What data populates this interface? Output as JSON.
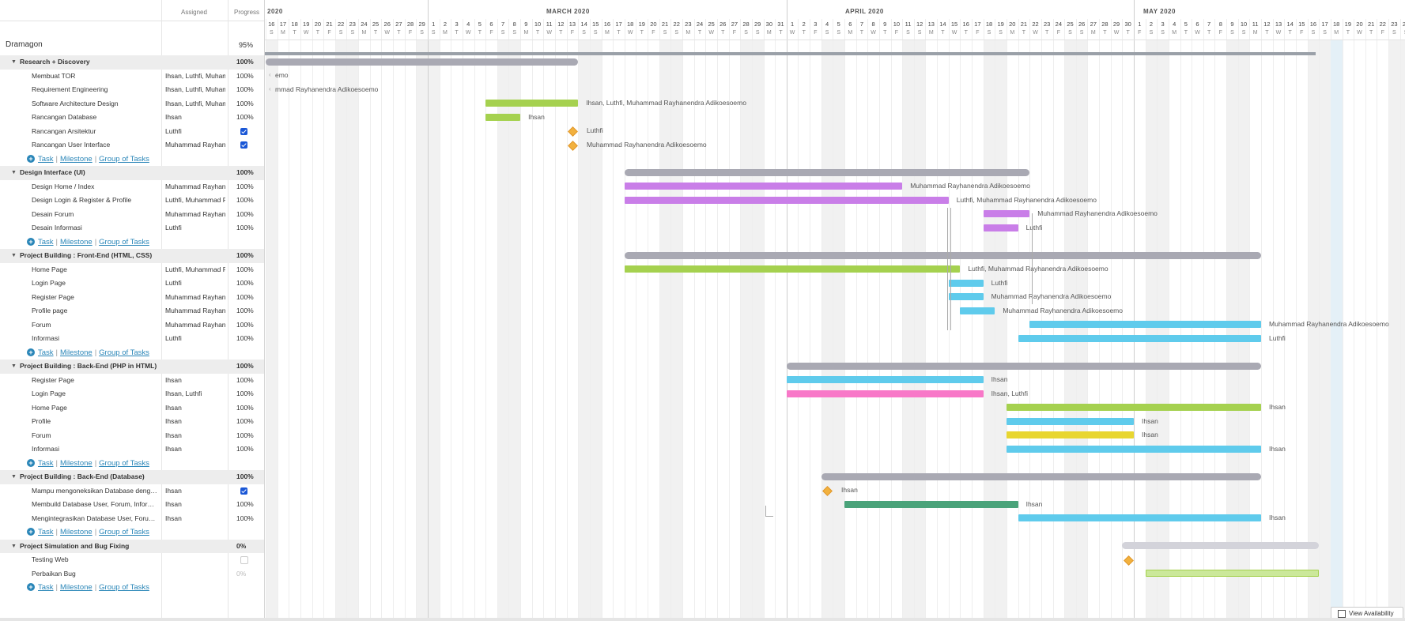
{
  "columns": {
    "assigned": "Assigned",
    "progress": "Progress"
  },
  "project": {
    "title": "Dramagon",
    "progress": "95%"
  },
  "rows": [
    {
      "type": "group",
      "name": "Research + Discovery",
      "progress": "100%"
    },
    {
      "type": "task",
      "name": "Membuat TOR",
      "assigned": "Ihsan, Luthfi, Muhammad Rayhanendra Adikoesoemo",
      "progress": "100%"
    },
    {
      "type": "task",
      "name": "Requirement Engineering",
      "assigned": "Ihsan, Luthfi, Muhammad Rayhanendra Adikoesoemo",
      "progress": "100%"
    },
    {
      "type": "task",
      "name": "Software Architecture Design",
      "assigned": "Ihsan, Luthfi, Muhammad Rayhanendra Adikoesoemo",
      "progress": "100%"
    },
    {
      "type": "task",
      "name": "Rancangan Database",
      "assigned": "Ihsan",
      "progress": "100%"
    },
    {
      "type": "milestone",
      "name": "Rancangan Arsitektur",
      "assigned": "Luthfi",
      "checked": true
    },
    {
      "type": "milestone",
      "name": "Rancangan User Interface",
      "assigned": "Muhammad Rayhanendra Adikoesoemo",
      "checked": true
    },
    {
      "type": "add"
    },
    {
      "type": "group",
      "name": "Design Interface (UI)",
      "progress": "100%"
    },
    {
      "type": "task",
      "name": "Design Home / Index",
      "assigned": "Muhammad Rayhanendra Adikoesoemo",
      "progress": "100%"
    },
    {
      "type": "task",
      "name": "Design Login & Register & Profile",
      "assigned": "Luthfi, Muhammad Rayhanendra Adikoesoemo",
      "progress": "100%"
    },
    {
      "type": "task",
      "name": "Desain Forum",
      "assigned": "Muhammad Rayhanendra Adikoesoemo",
      "progress": "100%"
    },
    {
      "type": "task",
      "name": "Desain Informasi",
      "assigned": "Luthfi",
      "progress": "100%"
    },
    {
      "type": "add"
    },
    {
      "type": "group",
      "name": "Project Building : Front-End (HTML, CSS)",
      "progress": "100%"
    },
    {
      "type": "task",
      "name": "Home Page",
      "assigned": "Luthfi, Muhammad Rayhanendra Adikoesoemo",
      "progress": "100%"
    },
    {
      "type": "task",
      "name": "Login Page",
      "assigned": "Luthfi",
      "progress": "100%"
    },
    {
      "type": "task",
      "name": "Register Page",
      "assigned": "Muhammad Rayhanendra Adikoesoemo",
      "progress": "100%"
    },
    {
      "type": "task",
      "name": "Profile page",
      "assigned": "Muhammad Rayhanendra Adikoesoemo",
      "progress": "100%"
    },
    {
      "type": "task",
      "name": "Forum",
      "assigned": "Muhammad Rayhanendra Adikoesoemo",
      "progress": "100%"
    },
    {
      "type": "task",
      "name": "Informasi",
      "assigned": "Luthfi",
      "progress": "100%"
    },
    {
      "type": "add"
    },
    {
      "type": "group",
      "name": "Project Building : Back-End (PHP in HTML)",
      "progress": "100%"
    },
    {
      "type": "task",
      "name": "Register Page",
      "assigned": "Ihsan",
      "progress": "100%"
    },
    {
      "type": "task",
      "name": "Login Page",
      "assigned": "Ihsan, Luthfi",
      "progress": "100%"
    },
    {
      "type": "task",
      "name": "Home Page",
      "assigned": "Ihsan",
      "progress": "100%"
    },
    {
      "type": "task",
      "name": "Profile",
      "assigned": "Ihsan",
      "progress": "100%"
    },
    {
      "type": "task",
      "name": "Forum",
      "assigned": "Ihsan",
      "progress": "100%"
    },
    {
      "type": "task",
      "name": "Informasi",
      "assigned": "Ihsan",
      "progress": "100%"
    },
    {
      "type": "add"
    },
    {
      "type": "group",
      "name": "Project Building : Back-End (Database)",
      "progress": "100%"
    },
    {
      "type": "milestone",
      "name": "Mampu mengoneksikan Database dengan PHP",
      "assigned": "Ihsan",
      "checked": true
    },
    {
      "type": "task",
      "name": "Membuild Database User, Forum, Informasi",
      "assigned": "Ihsan",
      "progress": "100%"
    },
    {
      "type": "task",
      "name": "Mengintegrasikan Database User, Forum, Informasi",
      "assigned": "Ihsan",
      "progress": "100%"
    },
    {
      "type": "add"
    },
    {
      "type": "group",
      "name": "Project Simulation and Bug Fixing",
      "progress": "0%"
    },
    {
      "type": "milestone",
      "name": "Testing Web",
      "assigned": "",
      "checked": false
    },
    {
      "type": "task",
      "name": "Perbaikan Bug",
      "assigned": "",
      "progress": "0%",
      "muted": true
    },
    {
      "type": "add"
    }
  ],
  "add_links": {
    "task": "Task",
    "milestone": "Milestone",
    "group": "Group of Tasks"
  },
  "timeline": {
    "months": [
      {
        "label": "2020"
      },
      {
        "label": "MARCH 2020"
      },
      {
        "label": "APRIL 2020"
      },
      {
        "label": "MAY 2020"
      }
    ],
    "days": [
      {
        "d": "16",
        "w": "S"
      },
      {
        "d": "17",
        "w": "M"
      },
      {
        "d": "18",
        "w": "T"
      },
      {
        "d": "19",
        "w": "W"
      },
      {
        "d": "20",
        "w": "T"
      },
      {
        "d": "21",
        "w": "F"
      },
      {
        "d": "22",
        "w": "S"
      },
      {
        "d": "23",
        "w": "S"
      },
      {
        "d": "24",
        "w": "M"
      },
      {
        "d": "25",
        "w": "T"
      },
      {
        "d": "26",
        "w": "W"
      },
      {
        "d": "27",
        "w": "T"
      },
      {
        "d": "28",
        "w": "F"
      },
      {
        "d": "29",
        "w": "S"
      },
      {
        "d": "1",
        "w": "S"
      },
      {
        "d": "2",
        "w": "M"
      },
      {
        "d": "3",
        "w": "T"
      },
      {
        "d": "4",
        "w": "W"
      },
      {
        "d": "5",
        "w": "T"
      },
      {
        "d": "6",
        "w": "F"
      },
      {
        "d": "7",
        "w": "S"
      },
      {
        "d": "8",
        "w": "S"
      },
      {
        "d": "9",
        "w": "M"
      },
      {
        "d": "10",
        "w": "T"
      },
      {
        "d": "11",
        "w": "W"
      },
      {
        "d": "12",
        "w": "T"
      },
      {
        "d": "13",
        "w": "F"
      },
      {
        "d": "14",
        "w": "S"
      },
      {
        "d": "15",
        "w": "S"
      },
      {
        "d": "16",
        "w": "M"
      },
      {
        "d": "17",
        "w": "T"
      },
      {
        "d": "18",
        "w": "W"
      },
      {
        "d": "19",
        "w": "T"
      },
      {
        "d": "20",
        "w": "F"
      },
      {
        "d": "21",
        "w": "S"
      },
      {
        "d": "22",
        "w": "S"
      },
      {
        "d": "23",
        "w": "M"
      },
      {
        "d": "24",
        "w": "T"
      },
      {
        "d": "25",
        "w": "W"
      },
      {
        "d": "26",
        "w": "T"
      },
      {
        "d": "27",
        "w": "F"
      },
      {
        "d": "28",
        "w": "S"
      },
      {
        "d": "29",
        "w": "S"
      },
      {
        "d": "30",
        "w": "M"
      },
      {
        "d": "31",
        "w": "T"
      },
      {
        "d": "1",
        "w": "W"
      },
      {
        "d": "2",
        "w": "T"
      },
      {
        "d": "3",
        "w": "F"
      },
      {
        "d": "4",
        "w": "S"
      },
      {
        "d": "5",
        "w": "S"
      },
      {
        "d": "6",
        "w": "M"
      },
      {
        "d": "7",
        "w": "T"
      },
      {
        "d": "8",
        "w": "W"
      },
      {
        "d": "9",
        "w": "T"
      },
      {
        "d": "10",
        "w": "F"
      },
      {
        "d": "11",
        "w": "S"
      },
      {
        "d": "12",
        "w": "S"
      },
      {
        "d": "13",
        "w": "M"
      },
      {
        "d": "14",
        "w": "T"
      },
      {
        "d": "15",
        "w": "W"
      },
      {
        "d": "16",
        "w": "T"
      },
      {
        "d": "17",
        "w": "F"
      },
      {
        "d": "18",
        "w": "S"
      },
      {
        "d": "19",
        "w": "S"
      },
      {
        "d": "20",
        "w": "M"
      },
      {
        "d": "21",
        "w": "T"
      },
      {
        "d": "22",
        "w": "W"
      },
      {
        "d": "23",
        "w": "T"
      },
      {
        "d": "24",
        "w": "F"
      },
      {
        "d": "25",
        "w": "S"
      },
      {
        "d": "26",
        "w": "S"
      },
      {
        "d": "27",
        "w": "M"
      },
      {
        "d": "28",
        "w": "T"
      },
      {
        "d": "29",
        "w": "W"
      },
      {
        "d": "30",
        "w": "T"
      },
      {
        "d": "1",
        "w": "F"
      },
      {
        "d": "2",
        "w": "S"
      },
      {
        "d": "3",
        "w": "S"
      },
      {
        "d": "4",
        "w": "M"
      },
      {
        "d": "5",
        "w": "T"
      },
      {
        "d": "6",
        "w": "W"
      },
      {
        "d": "7",
        "w": "T"
      },
      {
        "d": "8",
        "w": "F"
      },
      {
        "d": "9",
        "w": "S"
      },
      {
        "d": "10",
        "w": "S"
      },
      {
        "d": "11",
        "w": "M"
      },
      {
        "d": "12",
        "w": "T"
      },
      {
        "d": "13",
        "w": "W"
      },
      {
        "d": "14",
        "w": "T"
      },
      {
        "d": "15",
        "w": "F"
      },
      {
        "d": "16",
        "w": "S"
      },
      {
        "d": "17",
        "w": "S"
      },
      {
        "d": "18",
        "w": "M"
      },
      {
        "d": "19",
        "w": "T"
      },
      {
        "d": "20",
        "w": "W"
      },
      {
        "d": "21",
        "w": "T"
      },
      {
        "d": "22",
        "w": "F"
      },
      {
        "d": "23",
        "w": "S"
      },
      {
        "d": "24",
        "w": "S"
      }
    ],
    "today": "2020-05-18"
  },
  "bars": [
    {
      "row": 0,
      "kind": "group",
      "start": "2020-02-16",
      "end": "2020-03-13",
      "color": "#a9a9b3"
    },
    {
      "row": 1,
      "kind": "label-only",
      "label": "emo"
    },
    {
      "row": 2,
      "kind": "label-only",
      "label": "mmad Rayhanendra Adikoesoemo"
    },
    {
      "row": 3,
      "kind": "task",
      "start": "2020-03-06",
      "end": "2020-03-13",
      "color": "#a5d14f",
      "label": "Ihsan, Luthfi, Muhammad Rayhanendra Adikoesoemo"
    },
    {
      "row": 4,
      "kind": "task",
      "start": "2020-03-06",
      "end": "2020-03-08",
      "color": "#a5d14f",
      "label": "Ihsan"
    },
    {
      "row": 5,
      "kind": "milestone",
      "date": "2020-03-13",
      "label": "Luthfi"
    },
    {
      "row": 6,
      "kind": "milestone",
      "date": "2020-03-13",
      "label": "Muhammad Rayhanendra Adikoesoemo"
    },
    {
      "row": 8,
      "kind": "group",
      "start": "2020-03-18",
      "end": "2020-04-21",
      "color": "#a9a9b3"
    },
    {
      "row": 9,
      "kind": "task",
      "start": "2020-03-18",
      "end": "2020-04-10",
      "color": "#c97ee8",
      "label": "Muhammad Rayhanendra Adikoesoemo"
    },
    {
      "row": 10,
      "kind": "task",
      "start": "2020-03-18",
      "end": "2020-04-14",
      "color": "#c97ee8",
      "label": "Luthfi, Muhammad Rayhanendra Adikoesoemo"
    },
    {
      "row": 11,
      "kind": "task",
      "start": "2020-04-18",
      "end": "2020-04-21",
      "color": "#c97ee8",
      "label": "Muhammad Rayhanendra Adikoesoemo"
    },
    {
      "row": 12,
      "kind": "task",
      "start": "2020-04-18",
      "end": "2020-04-20",
      "color": "#c97ee8",
      "label": "Luthfi"
    },
    {
      "row": 14,
      "kind": "group",
      "start": "2020-03-18",
      "end": "2020-05-11",
      "color": "#a9a9b3"
    },
    {
      "row": 15,
      "kind": "task",
      "start": "2020-03-18",
      "end": "2020-04-15",
      "color": "#a5d14f",
      "label": "Luthfi, Muhammad Rayhanendra Adikoesoemo"
    },
    {
      "row": 16,
      "kind": "task",
      "start": "2020-04-15",
      "end": "2020-04-17",
      "color": "#5fcbec",
      "label": "Luthfi"
    },
    {
      "row": 17,
      "kind": "task",
      "start": "2020-04-15",
      "end": "2020-04-17",
      "color": "#5fcbec",
      "label": "Muhammad Rayhanendra Adikoesoemo"
    },
    {
      "row": 18,
      "kind": "task",
      "start": "2020-04-16",
      "end": "2020-04-18",
      "color": "#5fcbec",
      "label": "Muhammad Rayhanendra Adikoesoemo"
    },
    {
      "row": 19,
      "kind": "task",
      "start": "2020-04-22",
      "end": "2020-05-11",
      "color": "#5fcbec",
      "label": "Muhammad Rayhanendra Adikoesoemo"
    },
    {
      "row": 20,
      "kind": "task",
      "start": "2020-04-21",
      "end": "2020-05-11",
      "color": "#5fcbec",
      "label": "Luthfi"
    },
    {
      "row": 22,
      "kind": "group",
      "start": "2020-04-01",
      "end": "2020-05-11",
      "color": "#a9a9b3"
    },
    {
      "row": 23,
      "kind": "task",
      "start": "2020-04-01",
      "end": "2020-04-17",
      "color": "#5fcbec",
      "label": "Ihsan"
    },
    {
      "row": 24,
      "kind": "task",
      "start": "2020-04-01",
      "end": "2020-04-17",
      "color": "#f878c8",
      "label": "Ihsan, Luthfi"
    },
    {
      "row": 25,
      "kind": "task",
      "start": "2020-04-20",
      "end": "2020-05-11",
      "color": "#a5d14f",
      "label": "Ihsan"
    },
    {
      "row": 26,
      "kind": "task",
      "start": "2020-04-20",
      "end": "2020-04-30",
      "color": "#5fcbec",
      "label": "Ihsan"
    },
    {
      "row": 27,
      "kind": "task",
      "start": "2020-04-20",
      "end": "2020-04-30",
      "color": "#e8d630",
      "label": "Ihsan"
    },
    {
      "row": 28,
      "kind": "task",
      "start": "2020-04-20",
      "end": "2020-05-11",
      "color": "#5fcbec",
      "label": "Ihsan"
    },
    {
      "row": 30,
      "kind": "group",
      "start": "2020-04-04",
      "end": "2020-05-11",
      "color": "#a9a9b3"
    },
    {
      "row": 31,
      "kind": "milestone",
      "date": "2020-04-04",
      "label": "Ihsan"
    },
    {
      "row": 32,
      "kind": "task",
      "start": "2020-04-06",
      "end": "2020-04-20",
      "color": "#4aa37a",
      "label": "Ihsan"
    },
    {
      "row": 33,
      "kind": "task",
      "start": "2020-04-21",
      "end": "2020-05-11",
      "color": "#5fcbec",
      "label": "Ihsan"
    },
    {
      "row": 35,
      "kind": "group",
      "start": "2020-04-30",
      "end": "2020-05-16",
      "color": "#d3d3da"
    },
    {
      "row": 36,
      "kind": "milestone",
      "date": "2020-04-30",
      "label": ""
    },
    {
      "row": 37,
      "kind": "task",
      "start": "2020-05-02",
      "end": "2020-05-16",
      "color": "#cbe89a",
      "label": "",
      "outline": "#a5d14f"
    }
  ],
  "footer": {
    "view_availability": "View Availability"
  }
}
